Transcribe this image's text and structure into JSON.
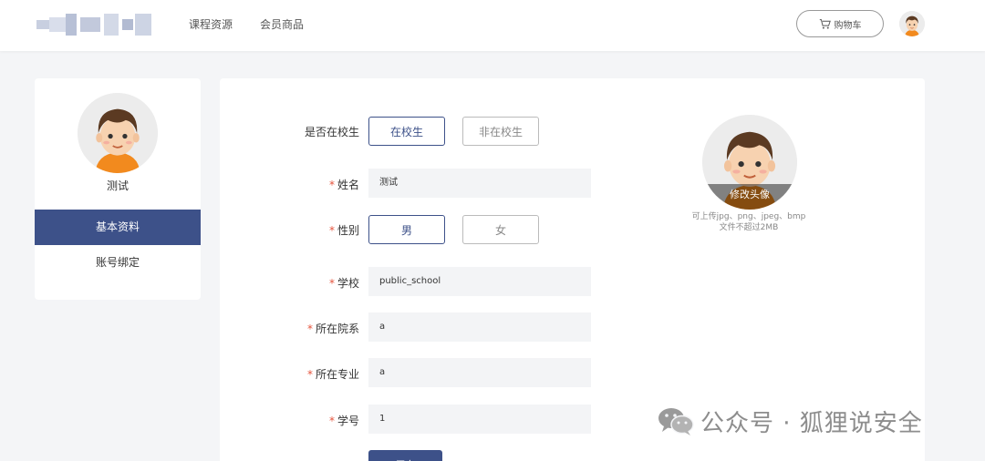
{
  "header": {
    "nav": [
      "课程资源",
      "会员商品"
    ],
    "cart_label": "购物车"
  },
  "sidebar": {
    "username": "测试",
    "menu": [
      "基本资料",
      "账号绑定"
    ]
  },
  "form": {
    "student_status": {
      "label": "是否在校生",
      "options": [
        "在校生",
        "非在校生"
      ],
      "selected": "在校生"
    },
    "name": {
      "label": "姓名",
      "value": "测试"
    },
    "gender": {
      "label": "性别",
      "options": [
        "男",
        "女"
      ],
      "selected": "男"
    },
    "school": {
      "label": "学校",
      "value": "public_school"
    },
    "department": {
      "label": "所在院系",
      "value": "a"
    },
    "major": {
      "label": "所在专业",
      "value": "a"
    },
    "student_id": {
      "label": "学号",
      "value": "1"
    },
    "submit_label": "保存"
  },
  "avatar_panel": {
    "overlay_label": "修改头像",
    "hint_line1": "可上传jpg、png、jpeg、bmp",
    "hint_line2": "文件不超过2MB"
  },
  "watermark": {
    "text": "公众号 · 狐狸说安全"
  },
  "colors": {
    "accent": "#3d5189",
    "required": "#e5533c",
    "input_bg": "#f3f4f6",
    "page_bg": "#f4f5f7"
  }
}
